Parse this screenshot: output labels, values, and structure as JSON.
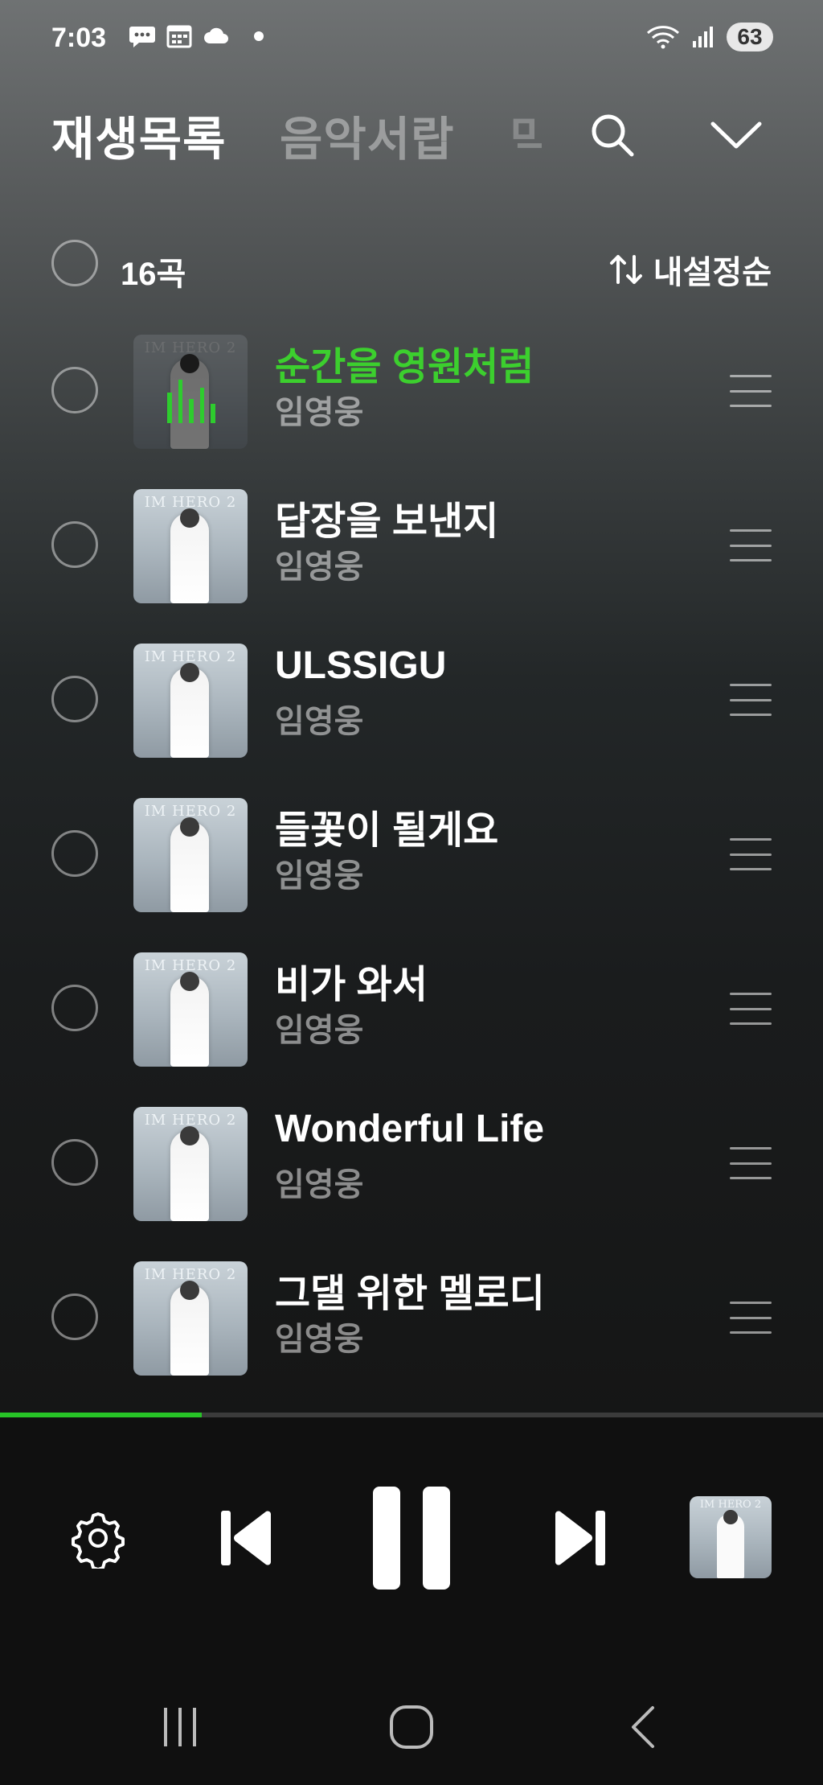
{
  "status_bar": {
    "time": "7:03",
    "battery": "63",
    "left_icons": [
      "chat-icon",
      "calendar-icon",
      "cloud-icon",
      "dot"
    ],
    "right_icons": [
      "wifi-icon",
      "signal-icon"
    ]
  },
  "header": {
    "tabs": [
      {
        "label": "재생목록",
        "active": true
      },
      {
        "label": "음악서랍",
        "active": false
      },
      {
        "label": "믹",
        "active": false
      }
    ]
  },
  "list_header": {
    "count_label": "16곡",
    "sort_label": "내설정순"
  },
  "songs": [
    {
      "title": "순간을 영원처럼",
      "artist": "임영웅",
      "playing": true
    },
    {
      "title": "답장을 보낸지",
      "artist": "임영웅",
      "playing": false
    },
    {
      "title": "ULSSIGU",
      "artist": "임영웅",
      "playing": false
    },
    {
      "title": "들꽃이 될게요",
      "artist": "임영웅",
      "playing": false
    },
    {
      "title": "비가 와서",
      "artist": "임영웅",
      "playing": false
    },
    {
      "title": "Wonderful Life",
      "artist": "임영웅",
      "playing": false
    },
    {
      "title": "그댈 위한 멜로디",
      "artist": "임영웅",
      "playing": false
    }
  ],
  "album_art_text": "IM HERO 2",
  "player": {
    "progress": 0.245,
    "state": "playing"
  },
  "colors": {
    "accent_green": "#3ccf2e",
    "progress_green": "#27c427"
  }
}
